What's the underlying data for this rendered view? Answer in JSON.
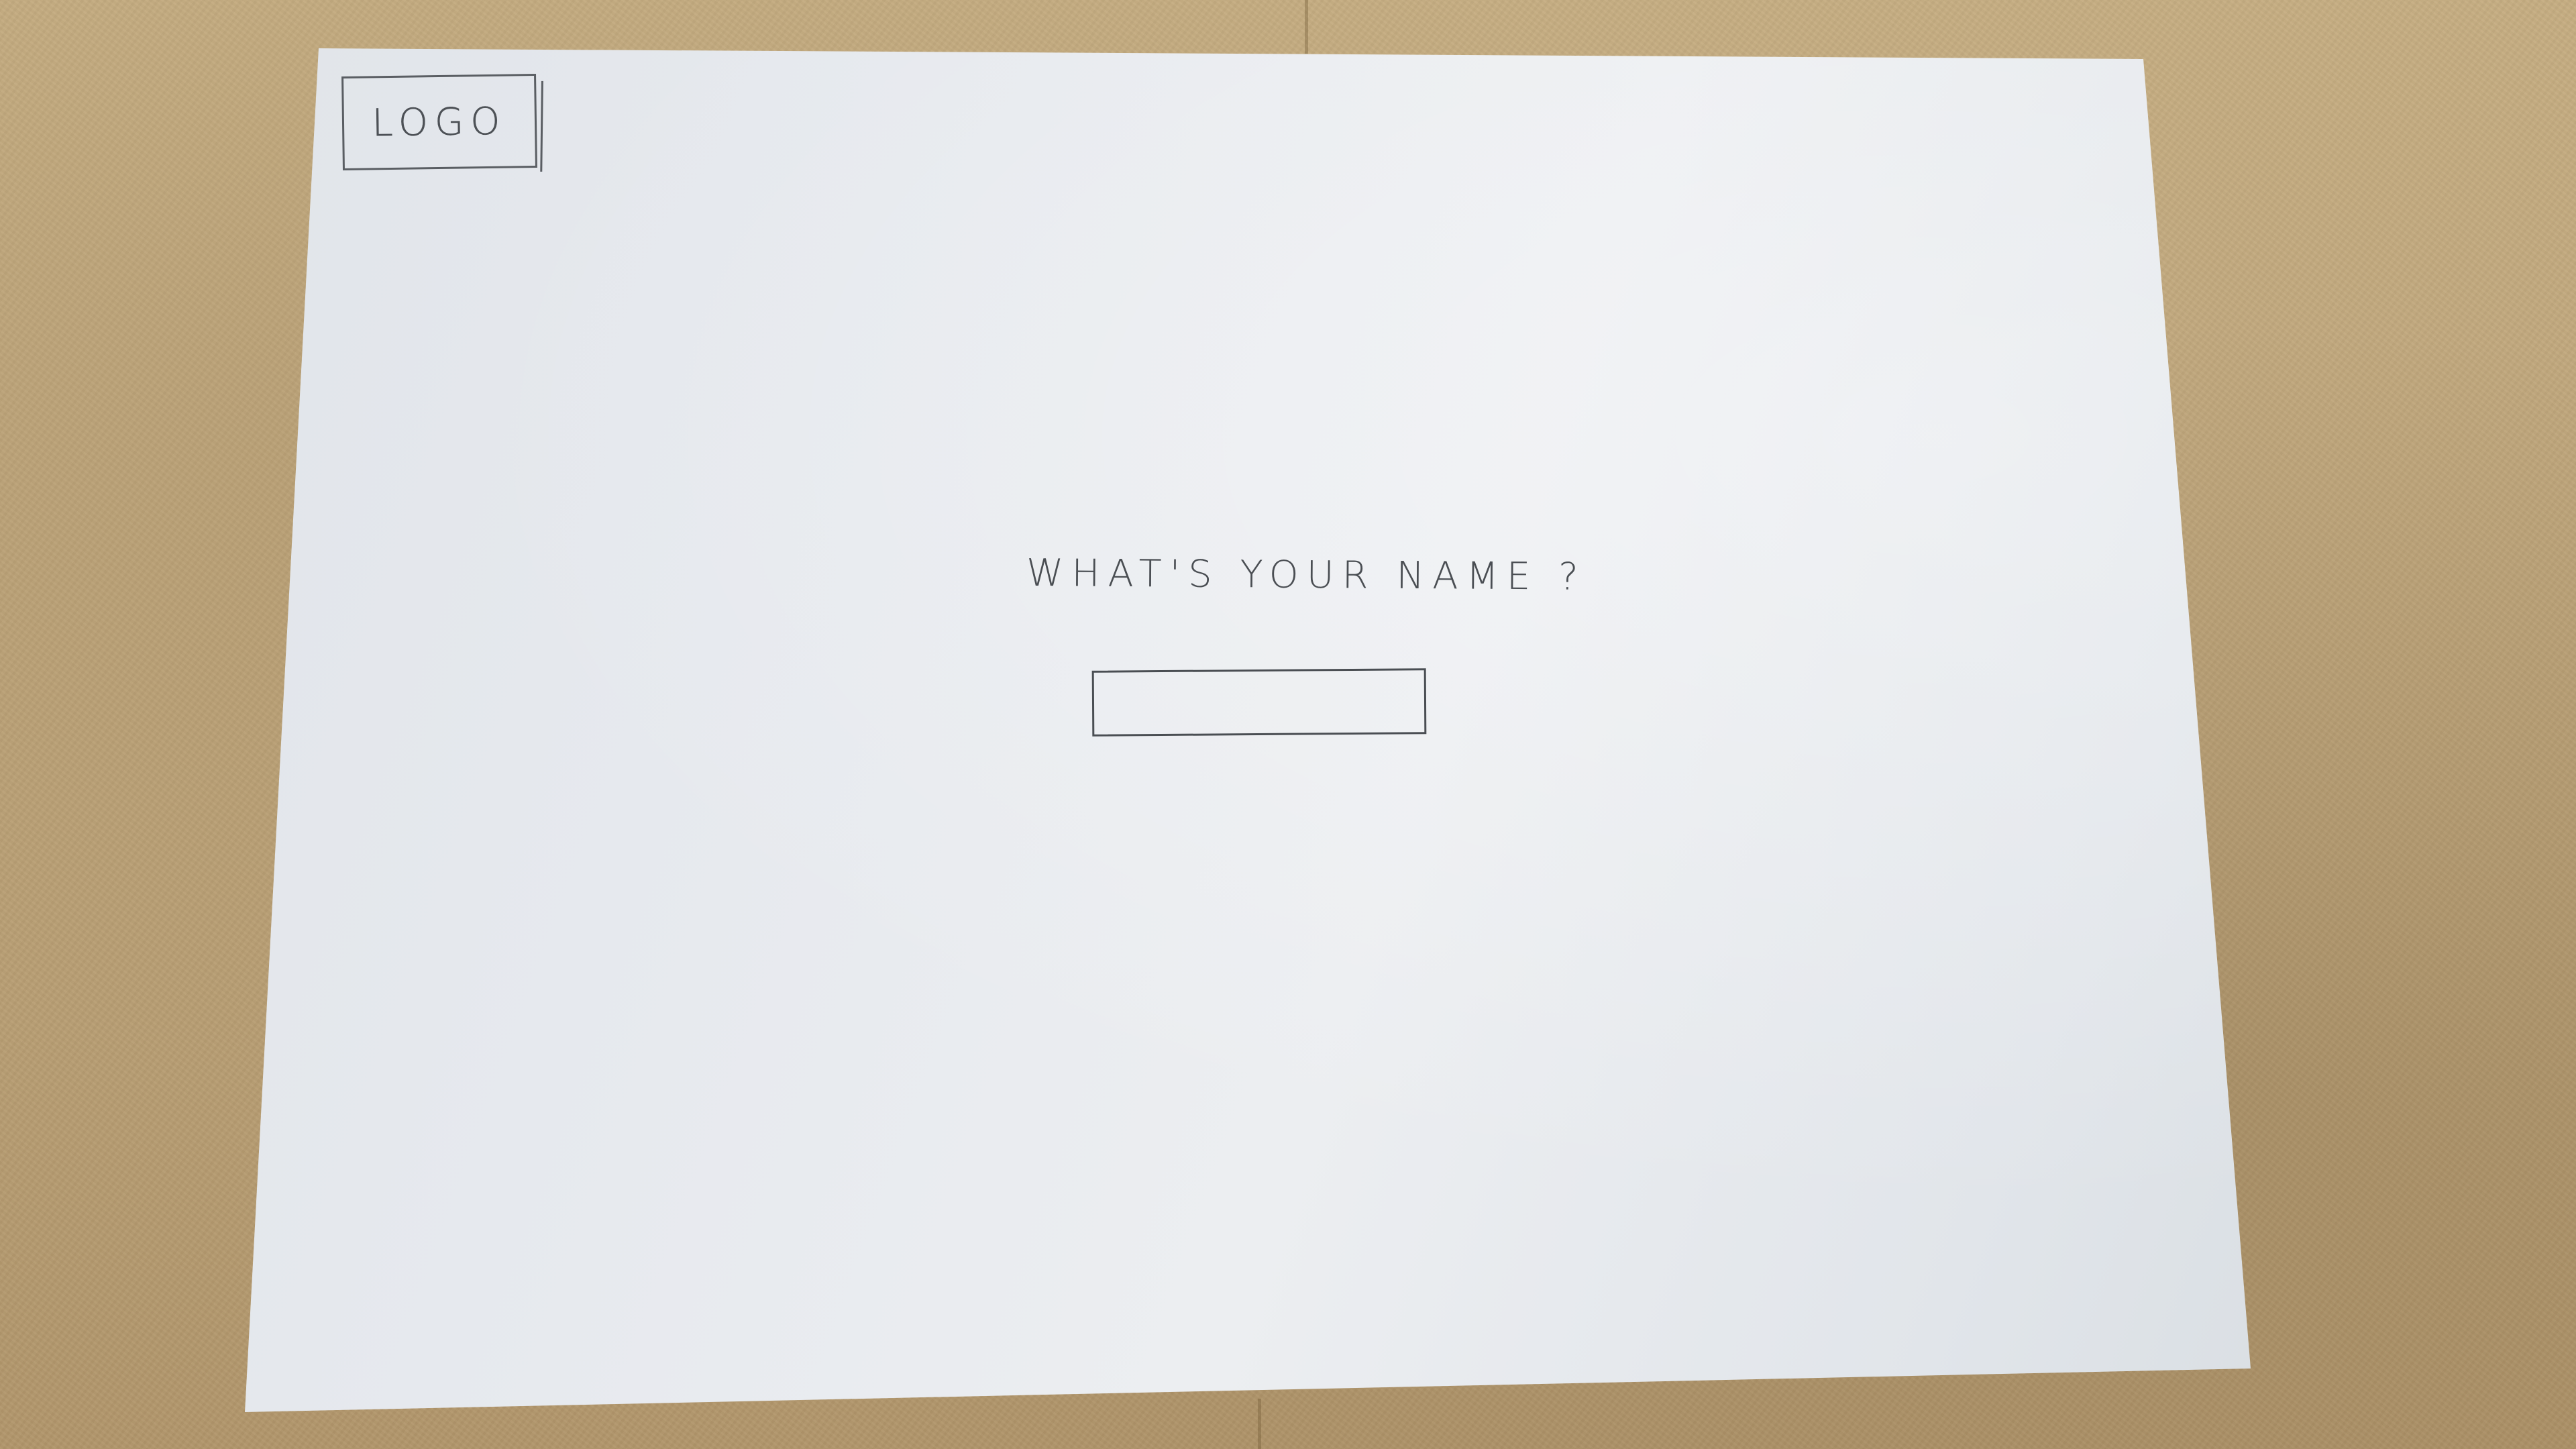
{
  "sketch": {
    "logo_label": "LOGO",
    "question": "WHAT'S YOUR NAME ?",
    "name_input_value": ""
  },
  "colors": {
    "paper": "#e6e9ee",
    "pencil": "#4a4e53",
    "background": "#c0a57a"
  }
}
